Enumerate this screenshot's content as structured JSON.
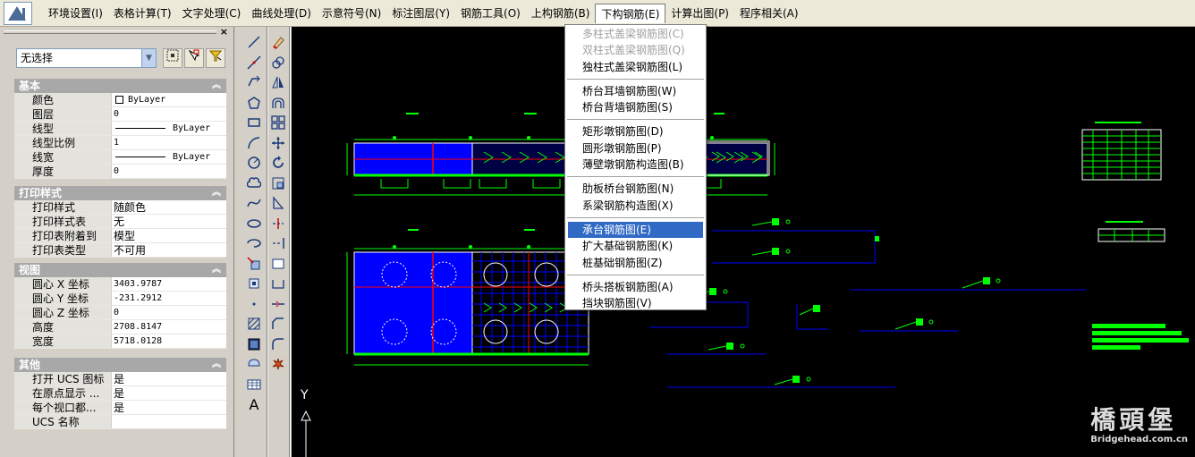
{
  "menubar": {
    "items": [
      "环境设置(I)",
      "表格计算(T)",
      "文字处理(C)",
      "曲线处理(D)",
      "示意符号(N)",
      "标注图层(Y)",
      "钢筋工具(O)",
      "上构钢筋(B)",
      "下构钢筋(E)",
      "计算出图(P)",
      "程序相关(A)"
    ],
    "active_index": 8
  },
  "properties": {
    "selector_value": "无选择",
    "sections": [
      {
        "title": "基本",
        "rows": [
          {
            "key": "颜色",
            "value": "ByLayer",
            "type": "swatch"
          },
          {
            "key": "图层",
            "value": "0"
          },
          {
            "key": "线型",
            "value": "ByLayer",
            "type": "line"
          },
          {
            "key": "线型比例",
            "value": "1"
          },
          {
            "key": "线宽",
            "value": "ByLayer",
            "type": "line"
          },
          {
            "key": "厚度",
            "value": "0"
          }
        ]
      },
      {
        "title": "打印样式",
        "rows": [
          {
            "key": "打印样式",
            "value": "随颜色",
            "type": "cn"
          },
          {
            "key": "打印样式表",
            "value": "无",
            "type": "cn"
          },
          {
            "key": "打印表附着到",
            "value": "模型",
            "type": "cn"
          },
          {
            "key": "打印表类型",
            "value": "不可用",
            "type": "cn"
          }
        ]
      },
      {
        "title": "视图",
        "rows": [
          {
            "key": "圆心 X 坐标",
            "value": "3403.9787"
          },
          {
            "key": "圆心 Y 坐标",
            "value": "-231.2912"
          },
          {
            "key": "圆心 Z 坐标",
            "value": "0"
          },
          {
            "key": "高度",
            "value": "2708.8147"
          },
          {
            "key": "宽度",
            "value": "5718.0128"
          }
        ]
      },
      {
        "title": "其他",
        "rows": [
          {
            "key": "打开 UCS 图标",
            "value": "是",
            "type": "cn"
          },
          {
            "key": "在原点显示 ...",
            "value": "是",
            "type": "cn"
          },
          {
            "key": "每个视口都...",
            "value": "是",
            "type": "cn"
          },
          {
            "key": "UCS 名称",
            "value": ""
          }
        ]
      }
    ]
  },
  "dropdown": {
    "groups": [
      [
        {
          "label": "多柱式盖梁钢筋图(C)",
          "disabled": true
        },
        {
          "label": "双柱式盖梁钢筋图(Q)",
          "disabled": true
        },
        {
          "label": "独柱式盖梁钢筋图(L)",
          "disabled": false
        }
      ],
      [
        {
          "label": "桥台耳墙钢筋图(W)",
          "disabled": false
        },
        {
          "label": "桥台背墙钢筋图(S)",
          "disabled": false
        }
      ],
      [
        {
          "label": "矩形墩钢筋图(D)",
          "disabled": false
        },
        {
          "label": "圆形墩钢筋图(P)",
          "disabled": false
        },
        {
          "label": "薄壁墩钢筋构造图(B)",
          "disabled": false
        }
      ],
      [
        {
          "label": "肋板桥台钢筋图(N)",
          "disabled": false
        },
        {
          "label": "系梁钢筋构造图(X)",
          "disabled": false
        }
      ],
      [
        {
          "label": "承台钢筋图(E)",
          "disabled": false,
          "selected": true
        },
        {
          "label": "扩大基础钢筋图(K)",
          "disabled": false
        },
        {
          "label": "桩基础钢筋图(Z)",
          "disabled": false
        }
      ],
      [
        {
          "label": "桥头搭板钢筋图(A)",
          "disabled": false
        },
        {
          "label": "挡块钢筋图(V)",
          "disabled": false
        }
      ]
    ]
  },
  "canvas": {
    "ucs_label": "Y"
  },
  "watermark": {
    "cn": "橋頭堡",
    "en": "Bridgehead.com.cn"
  },
  "colors": {
    "drawing_blue": "#0000ff",
    "drawing_green": "#00ff00",
    "drawing_red": "#ff0000",
    "menu_highlight": "#316ac5"
  }
}
